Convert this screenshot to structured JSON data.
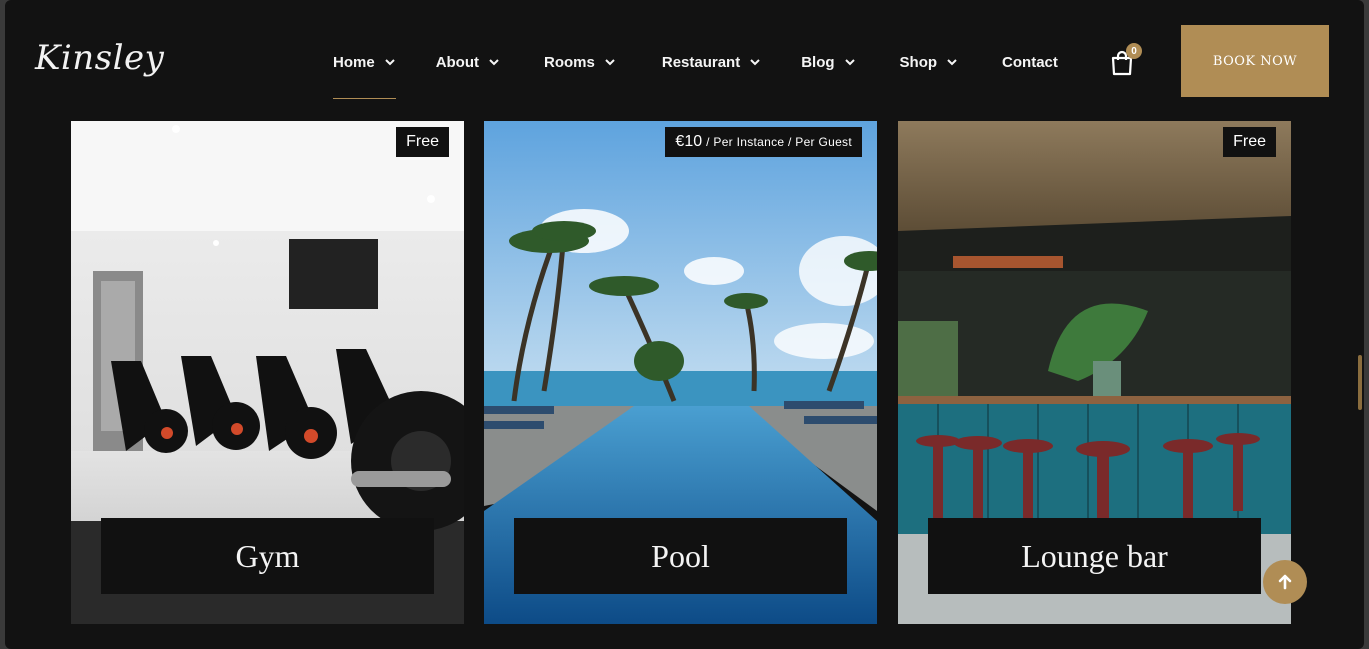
{
  "header": {
    "logo": "Kinsley",
    "nav": [
      {
        "label": "Home",
        "has_dropdown": true,
        "active": true
      },
      {
        "label": "About",
        "has_dropdown": true
      },
      {
        "label": "Rooms",
        "has_dropdown": true
      },
      {
        "label": "Restaurant",
        "has_dropdown": true
      },
      {
        "label": "Blog",
        "has_dropdown": true
      },
      {
        "label": "Shop",
        "has_dropdown": true
      },
      {
        "label": "Contact",
        "has_dropdown": false
      }
    ],
    "cart_count": "0",
    "book_now": "BOOK NOW"
  },
  "cards": [
    {
      "title": "Gym",
      "price": "Free",
      "price_sub": ""
    },
    {
      "title": "Pool",
      "price": "€10",
      "price_sub": "/ Per Instance / Per Guest"
    },
    {
      "title": "Lounge bar",
      "price": "Free",
      "price_sub": ""
    }
  ],
  "colors": {
    "accent": "#b08d55",
    "background": "#121212",
    "text": "#f5f5f5"
  },
  "icons": {
    "cart": "cart-icon",
    "scroll_top": "arrow-up-icon",
    "dropdown": "chevron-down-icon"
  }
}
